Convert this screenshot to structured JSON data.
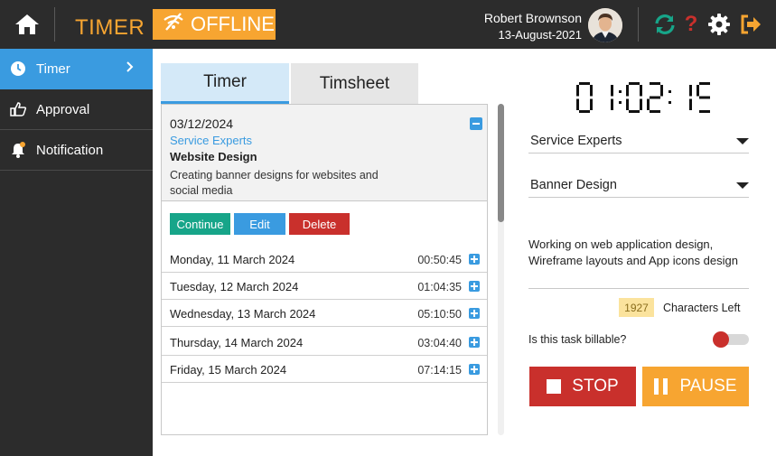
{
  "header": {
    "app_title": "TIMER",
    "offline_label": "OFFLINE",
    "user_name": "Robert Brownson",
    "user_date": "13-August-2021",
    "icons": [
      "home-icon",
      "offline-icon",
      "sync-icon",
      "help-icon",
      "settings-icon",
      "logout-icon"
    ],
    "colors": {
      "accent": "#f7a531",
      "sync": "#17a589",
      "help": "#c9302c"
    }
  },
  "sidebar": {
    "items": [
      {
        "label": "Timer",
        "icon": "clock-icon",
        "active": true
      },
      {
        "label": "Approval",
        "icon": "thumb-up-icon",
        "active": false
      },
      {
        "label": "Notification",
        "icon": "bell-icon",
        "active": false
      }
    ]
  },
  "tabs": [
    {
      "label": "Timer",
      "active": true
    },
    {
      "label": "Timsheet",
      "active": false
    }
  ],
  "entry": {
    "date": "03/12/2024",
    "client": "Service Experts",
    "task": "Website Design",
    "description": "Creating banner designs for websites and social media",
    "buttons": {
      "continue": "Continue",
      "edit": "Edit",
      "delete": "Delete"
    }
  },
  "days": [
    {
      "date": "Monday, 11 March 2024",
      "time": "00:50:45"
    },
    {
      "date": "Tuesday, 12 March 2024",
      "time": "01:04:35"
    },
    {
      "date": "Wednesday, 13 March 2024",
      "time": "05:10:50"
    },
    {
      "date": "Thursday, 14 March 2024",
      "time": "03:04:40"
    },
    {
      "date": "Friday, 15 March 2024",
      "time": "07:14:15"
    }
  ],
  "timer": {
    "display": "01:02:15",
    "client_select": "Service Experts",
    "task_select": "Banner Design",
    "note": "Working on web application design, Wireframe layouts and App icons design",
    "chars_left": "1927",
    "chars_left_label": "Characters Left",
    "billable_label": "Is this task billable?",
    "billable": true,
    "stop_label": "STOP",
    "pause_label": "PAUSE"
  }
}
